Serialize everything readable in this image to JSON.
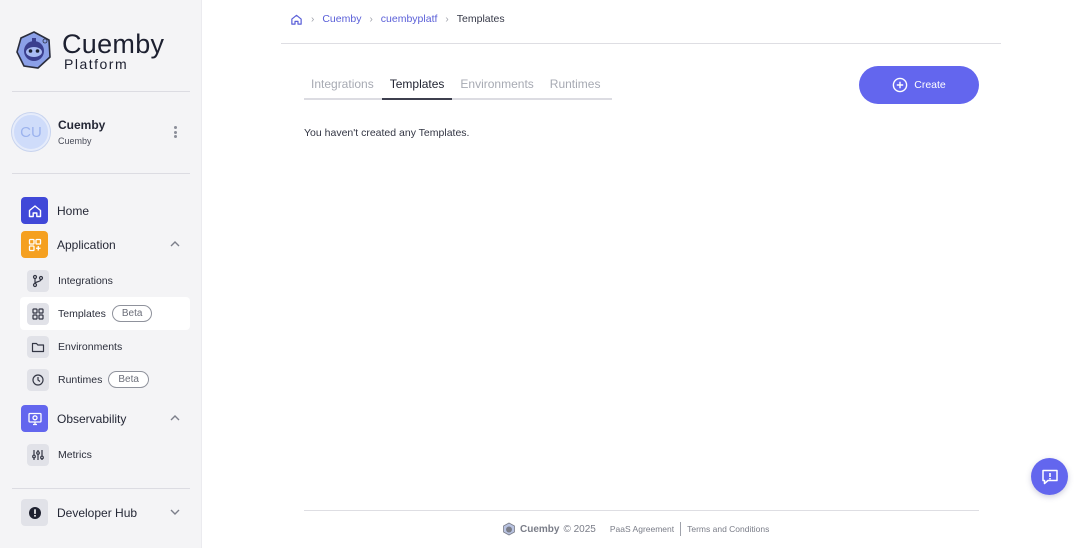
{
  "app": {
    "brand_title": "Cuemby",
    "brand_subtitle": "Platform"
  },
  "profile": {
    "initials": "CU",
    "name": "Cuemby",
    "org": "Cuemby"
  },
  "sidebar": {
    "home_label": "Home",
    "application_label": "Application",
    "observability_label": "Observability",
    "developer_hub_label": "Developer Hub",
    "items": [
      {
        "label": "Integrations"
      },
      {
        "label": "Templates",
        "badge": "Beta"
      },
      {
        "label": "Environments"
      },
      {
        "label": "Runtimes",
        "badge": "Beta"
      },
      {
        "label": "Metrics"
      }
    ],
    "colors": {
      "home": "#4048d8",
      "application": "#f5a020",
      "observability": "#6366ee",
      "developer_hub": "#e1e2e8"
    }
  },
  "breadcrumb": {
    "items": [
      "Cuemby",
      "cuembyplatf"
    ],
    "current": "Templates"
  },
  "tabs": [
    {
      "label": "Integrations"
    },
    {
      "label": "Templates",
      "active": true
    },
    {
      "label": "Environments"
    },
    {
      "label": "Runtimes"
    }
  ],
  "actions": {
    "create_label": "Create"
  },
  "content": {
    "empty_message": "You haven't created any Templates."
  },
  "footer": {
    "brand": "Cuemby",
    "copyright": "© 2025",
    "paas_link": "PaaS Agreement",
    "terms_link": "Terms and Conditions"
  },
  "theme": {
    "accent": "#6366ee"
  }
}
